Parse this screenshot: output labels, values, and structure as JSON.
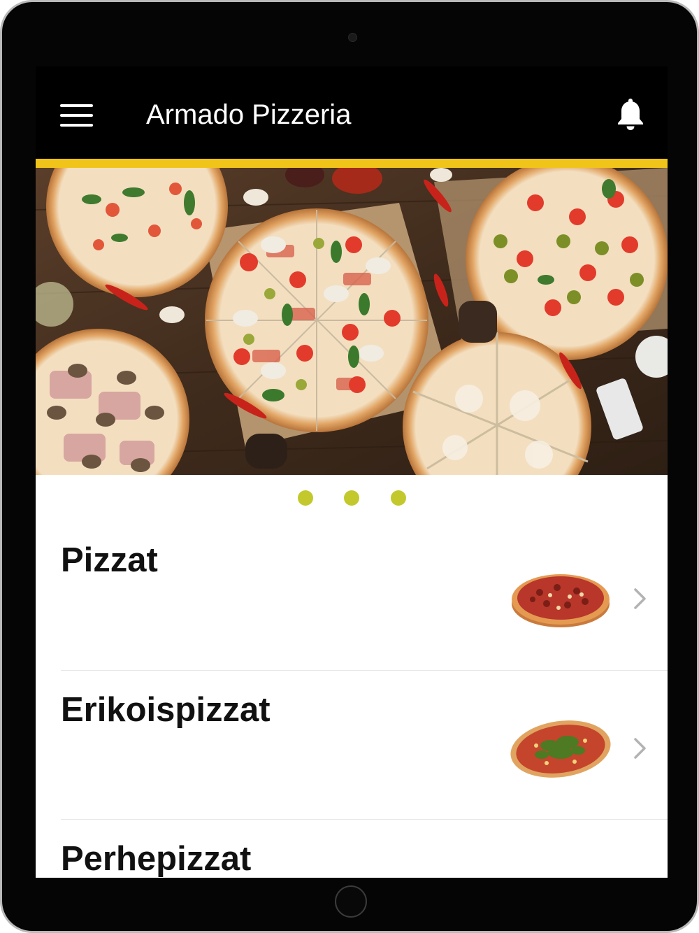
{
  "app": {
    "title": "Armado Pizzeria",
    "accent_color": "#f0c419",
    "dot_color": "#c3c92c",
    "header_color": "#000000"
  },
  "header": {
    "menu_icon": "hamburger-menu-icon",
    "notification_icon": "bell-icon"
  },
  "carousel": {
    "image": "pizzas-on-wooden-table-photo",
    "page_count": 3
  },
  "categories": [
    {
      "label": "Pizzat",
      "image": "pizza-thumbnail",
      "icon": "chevron-right-icon"
    },
    {
      "label": "Erikoispizzat",
      "image": "special-pizza-thumbnail",
      "icon": "chevron-right-icon"
    },
    {
      "label": "Perhepizzat"
    }
  ]
}
